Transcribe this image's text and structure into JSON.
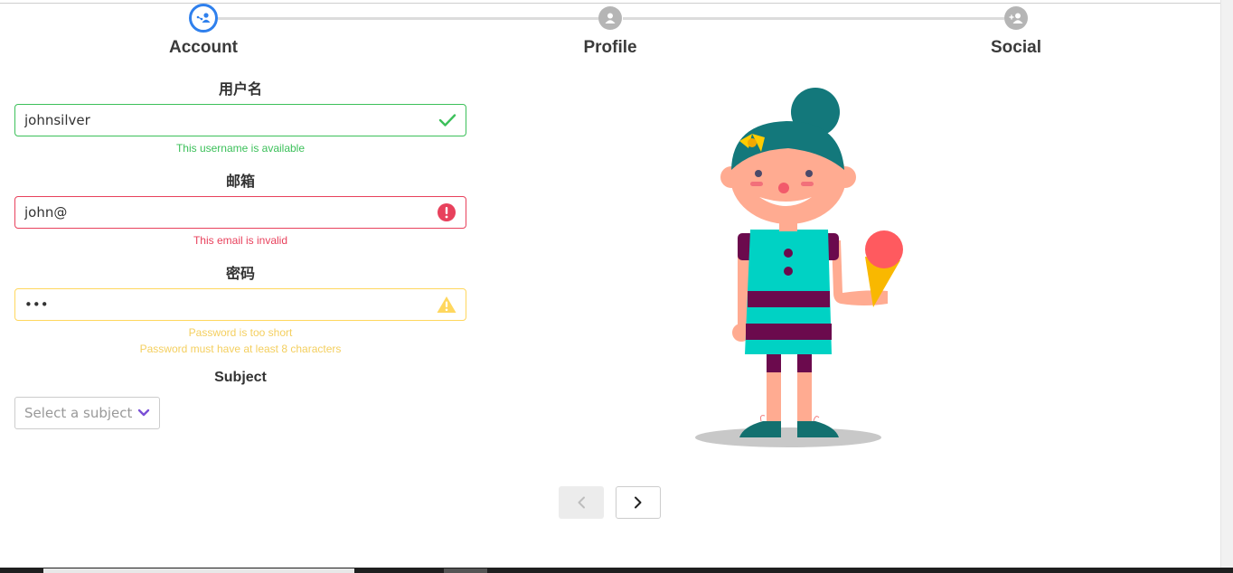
{
  "stepper": {
    "steps": [
      {
        "label": "Account",
        "icon": "share-person-icon",
        "state": "active"
      },
      {
        "label": "Profile",
        "icon": "user-icon",
        "state": "inactive"
      },
      {
        "label": "Social",
        "icon": "add-user-icon",
        "state": "inactive"
      }
    ],
    "active_color": "#2f80ed",
    "inactive_color": "#b5b5b5"
  },
  "form": {
    "username": {
      "label": "用户名",
      "value": "johnsilver",
      "state": "success",
      "message": "This username is available",
      "icon": "check-icon"
    },
    "email": {
      "label": "邮箱",
      "value": "john@",
      "state": "error",
      "message": "This email is invalid",
      "icon": "exclamation-circle-icon"
    },
    "password": {
      "label": "密码",
      "value": "•••",
      "state": "warning",
      "messages": [
        "Password is too short",
        "Password must have at least 8 characters"
      ],
      "icon": "warning-triangle-icon"
    },
    "subject": {
      "label": "Subject",
      "placeholder": "Select a subject",
      "icon": "chevron-down-icon"
    }
  },
  "colors": {
    "success": "#3cc05a",
    "error": "#e8415c",
    "warning": "#ffd75e"
  },
  "navigation": {
    "prev_icon": "chevron-left-icon",
    "next_icon": "chevron-right-icon"
  }
}
